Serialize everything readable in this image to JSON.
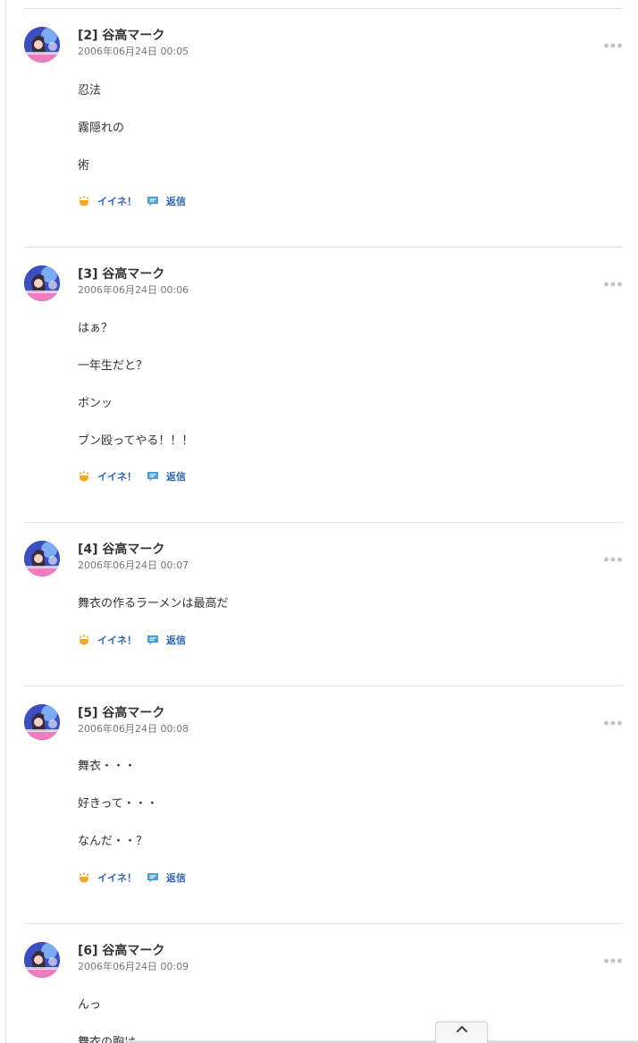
{
  "comments": [
    {
      "name": "[2] 谷高マーク",
      "date": "2006年06月24日 00:05",
      "lines": [
        "忍法",
        "霧隠れの",
        "術"
      ],
      "like_label": "イイネ！",
      "reply_label": "返信"
    },
    {
      "name": "[3] 谷高マーク",
      "date": "2006年06月24日 00:06",
      "lines": [
        "はぁ？",
        "一年生だと？",
        "ボンッ",
        "ブン殴ってやる！！！"
      ],
      "like_label": "イイネ！",
      "reply_label": "返信"
    },
    {
      "name": "[4] 谷高マーク",
      "date": "2006年06月24日 00:07",
      "lines": [
        "舞衣の作るラーメンは最高だ"
      ],
      "like_label": "イイネ！",
      "reply_label": "返信"
    },
    {
      "name": "[5] 谷高マーク",
      "date": "2006年06月24日 00:08",
      "lines": [
        "舞衣・・・",
        "好きって・・・",
        "なんだ・・？"
      ],
      "like_label": "イイネ！",
      "reply_label": "返信"
    },
    {
      "name": "[6] 谷高マーク",
      "date": "2006年06月24日 00:09",
      "lines": [
        "んっ",
        "舞衣の胸は"
      ]
    }
  ],
  "icons": {
    "avatar": "avatar-image",
    "menu": "more-dots-icon",
    "like": "hand-like-icon",
    "reply": "speech-bubble-icon",
    "scroll_top": "chevron-up-icon"
  },
  "colors": {
    "link": "#2a64b7",
    "like_icon": "#f5a623",
    "reply_icon": "#4a9fd8",
    "divider": "#e3e3e3"
  }
}
